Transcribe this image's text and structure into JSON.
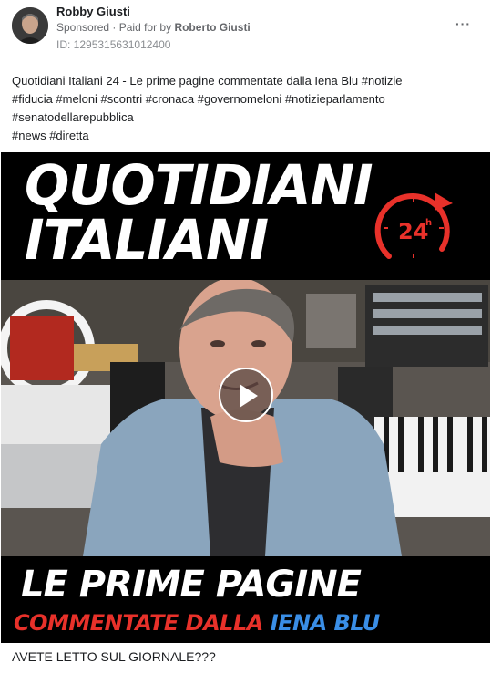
{
  "post": {
    "author": "Robby Giusti",
    "sponsored_label": "Sponsored",
    "paid_prefix": "· Paid for by",
    "paid_by": "Roberto Giusti",
    "ad_id": "ID: 1295315631012400",
    "more_label": "···",
    "text_lines": [
      "Quotidiani Italiani 24 - Le prime pagine commentate dalla Iena Blu #notizie",
      "#fiducia #meloni #scontri #cronaca #governomeloni #notizieparlamento",
      "#senatodellarepubblica",
      "#news #diretta"
    ],
    "caption": "AVETE LETTO SUL GIORNALE???"
  },
  "video": {
    "title_line1": "QUOTIDIANI",
    "title_line2": "ITALIANI",
    "clock_label": "24",
    "clock_sup": "h",
    "bottom_line1": "LE PRIME PAGINE",
    "bottom_line2_red": "COMMENTATE DALLA",
    "bottom_line2_blue": "IENA BLU",
    "play_icon": "play-icon"
  },
  "colors": {
    "accent_red": "#e8312a",
    "accent_blue": "#3a8ee6",
    "meta_gray": "#65676b"
  }
}
